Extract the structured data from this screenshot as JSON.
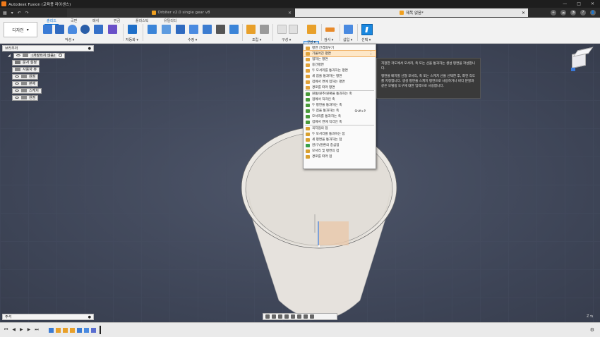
{
  "titlebar": {
    "title": "Autodesk Fusion (교육용 라이센스)",
    "controls": [
      "—",
      "□",
      "✕"
    ]
  },
  "tabs": {
    "quick_access": [
      "▦",
      "▾",
      "↶",
      "↷"
    ],
    "inactive": "Orbiter v2.0 single gear v8",
    "active": "제목 없음*",
    "close": "✕",
    "right_icons": [
      "+",
      "☁",
      "◔",
      "?",
      "👤"
    ]
  },
  "ribbon": {
    "workspace": "디자인",
    "workspace_caret": "▾",
    "tabs": [
      "솔리드",
      "곡면",
      "메쉬",
      "판금",
      "플라스틱",
      "유틸리티"
    ],
    "groups": [
      "작성 ▾",
      "자동화 ▾",
      "수정 ▾",
      "조립 ▾",
      "구성 ▾",
      "검사 ▾",
      "삽입 ▾",
      "선택 ▾"
    ],
    "construct_label": "구성 ▾"
  },
  "browser": {
    "title": "브라우저",
    "pin": "●",
    "root": "(저장되지 않음)",
    "items": [
      "문서 설정",
      "사용자 뷰",
      "원점",
      "본체",
      "스케치",
      "원점"
    ]
  },
  "comments": {
    "label": "주석",
    "pin": "●"
  },
  "menu": {
    "items": [
      {
        "label": "평면 간격띄우기",
        "color": "#e0a23a"
      },
      {
        "label": "기울어진 평면",
        "color": "#e0a23a",
        "highlight": true,
        "more": "⋮"
      },
      {
        "label": "접하는 평면",
        "color": "#e0a23a"
      },
      {
        "label": "중간평면",
        "color": "#e0a23a"
      },
      {
        "label": "두 모서리를 통과하는 평면",
        "color": "#e0a23a"
      },
      {
        "label": "세 점을 통과하는 평면",
        "color": "#e0a23a"
      },
      {
        "label": "점에서 면에 접하는 평면",
        "color": "#e0a23a"
      },
      {
        "label": "경로를 따라 평면",
        "color": "#e0a23a"
      },
      {
        "sep": true
      },
      {
        "label": "원통/원추/원환을 통과하는 축",
        "color": "#4a9a3a"
      },
      {
        "label": "점에서 직각인 축",
        "color": "#4a9a3a"
      },
      {
        "label": "두 평면을 통과하는 축",
        "color": "#4a9a3a"
      },
      {
        "label": "두 점을 통과하는 축",
        "color": "#4a9a3a",
        "shortcut": "Shift+P"
      },
      {
        "label": "모서리를 통과하는 축",
        "color": "#4a9a3a"
      },
      {
        "label": "점에서 면에 직각인 축",
        "color": "#4a9a3a"
      },
      {
        "sep": true
      },
      {
        "label": "꼭지점의 점",
        "color": "#d8a030"
      },
      {
        "label": "두 모서리를 통과하는 점",
        "color": "#d8a030"
      },
      {
        "label": "세 평면을 통과하는 점",
        "color": "#d8a030"
      },
      {
        "label": "원/구/원환의 중심점",
        "color": "#3aa04a"
      },
      {
        "label": "모서리 및 평면의 점",
        "color": "#d8a030"
      },
      {
        "label": "경로를 따라 점",
        "color": "#d8a030"
      }
    ]
  },
  "tooltip": {
    "line1": "지정한 각도에서 모서리, 축 또는 선을 통과하는 생성 평면을 작성합니다.",
    "line2": "평면을 배치할 선형 모서리, 축 또는 스케치 선을 선택한 후, 회전 각도를 지정합니다. 생성 평면을 스케치 평면으로 사용하거나 바디 분할과 같은 모델링 도구에 대한 입력으로 사용합니다."
  },
  "timeline": {
    "controls": [
      "⏮",
      "◀",
      "▶",
      "▶",
      "⏭"
    ],
    "gear": "⚙"
  },
  "zoom_indicator": "Z ⇆",
  "colors": {
    "accent": "#0a6fd0",
    "viewport": "#3d4456",
    "highlight": "#fde7c8"
  }
}
